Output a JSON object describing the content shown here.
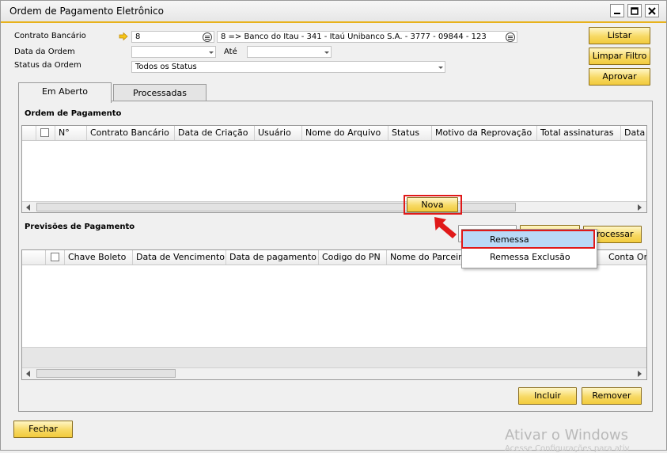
{
  "window": {
    "title": "Ordem de Pagamento Eletrônico"
  },
  "form": {
    "contrato_label": "Contrato Bancário",
    "contrato_value": "8",
    "contrato_desc": "8 => Banco do Itau - 341 - Itaú Unibanco  S.A. - 3777 - 09844 - 123",
    "data_ordem_label": "Data da Ordem",
    "ate_label": "Até",
    "status_label": "Status da Ordem",
    "status_value": "Todos os Status"
  },
  "actions": {
    "listar": "Listar",
    "limpar": "Limpar Filtro",
    "aprovar": "Aprovar"
  },
  "tabs": [
    {
      "label": "Em Aberto"
    },
    {
      "label": "Processadas"
    }
  ],
  "ordem": {
    "title": "Ordem de Pagamento",
    "columns": [
      "N°",
      "Contrato Bancário",
      "Data de Criação",
      "Usuário",
      "Nome do Arquivo",
      "Status",
      "Motivo da Reprovação",
      "Total assinaturas",
      "Data c"
    ],
    "nova_button": "Nova"
  },
  "previsoes": {
    "title": "Previsões de Pagamento",
    "columns": [
      "Chave Boleto",
      "Data de Vencimento",
      "Data de pagamento",
      "Codigo do PN",
      "Nome do Parceiro c",
      "Conta Ori"
    ],
    "processar": "Processar",
    "incluir": "Incluir",
    "remover": "Remover"
  },
  "menu": {
    "items": [
      "Remessa",
      "Remessa Exclusão"
    ]
  },
  "footer": {
    "fechar": "Fechar"
  },
  "watermark": {
    "line1": "Ativar o Windows",
    "line2": "Acesse Configurações para ativ"
  },
  "colors": {
    "accent": "#e8b21b",
    "highlight": "#e01919",
    "menu_hover": "#b9d9f7"
  }
}
